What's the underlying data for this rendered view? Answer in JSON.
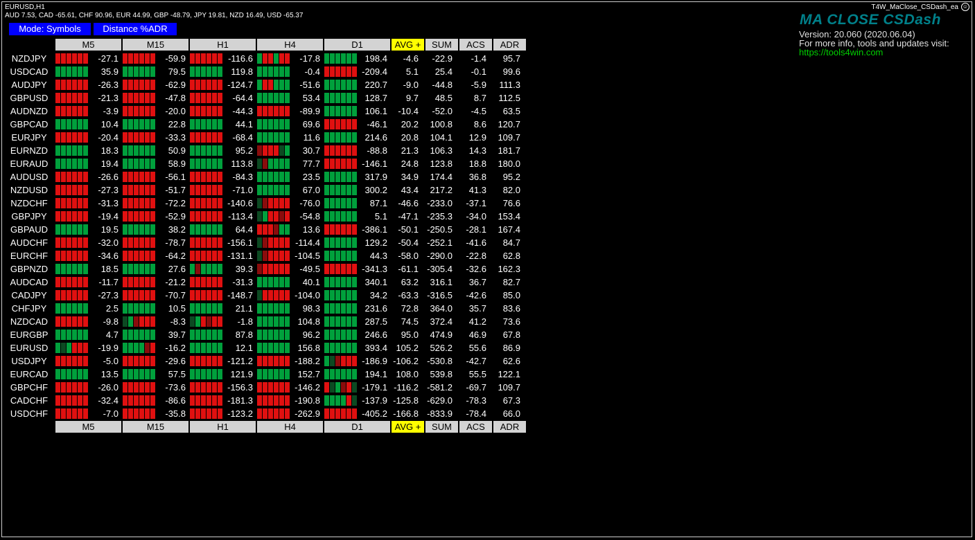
{
  "chart": {
    "title": "EURUSD,H1",
    "ea_name": "T4W_MaClose_CSDash_ea"
  },
  "currency_strength": "AUD 7.53, CAD -65.61, CHF 90.96, EUR 44.99, GBP -48.79, JPY 19.81, NZD 16.49, USD -65.37",
  "buttons": {
    "mode": "Mode: Symbols",
    "distance": "Distance %ADR"
  },
  "brand": {
    "title": "MA CLOSE CSDash",
    "version": "Version: 20.060 (2020.06.04)",
    "info": "For more info, tools and updates visit:",
    "link": "https://tools4win.com"
  },
  "colors": {
    "green": "#00a03c",
    "red": "#e01010",
    "dark_green": "#0c4a22",
    "dark_red": "#8a0c0c",
    "button_blue": "#0000ff",
    "avg_yellow": "#ffff00",
    "header_gray": "#d3d3d3",
    "brand_teal": "#00808a",
    "link_green": "#00d000"
  },
  "table": {
    "timeframes": [
      "M5",
      "M15",
      "H1",
      "H4",
      "D1"
    ],
    "stat_headers": [
      "AVG +",
      "SUM",
      "ACS",
      "ADR"
    ],
    "rows": [
      {
        "symbol": "NZDJPY",
        "tf": [
          [
            "rrrrrr",
            "-27.1"
          ],
          [
            "rrrrrr",
            "-59.9"
          ],
          [
            "rrrrrr",
            "-116.6"
          ],
          [
            "grrgrr",
            "-17.8"
          ],
          [
            "gggggg",
            "198.4"
          ]
        ],
        "avg": "-4.6",
        "sum": "-22.9",
        "acs": "-1.4",
        "adr": "95.7"
      },
      {
        "symbol": "USDCAD",
        "tf": [
          [
            "gggggg",
            "35.9"
          ],
          [
            "gggggg",
            "79.5"
          ],
          [
            "gggggg",
            "119.8"
          ],
          [
            "gggggg",
            "-0.4"
          ],
          [
            "rrrrrr",
            "-209.4"
          ]
        ],
        "avg": "5.1",
        "sum": "25.4",
        "acs": "-0.1",
        "adr": "99.6"
      },
      {
        "symbol": "AUDJPY",
        "tf": [
          [
            "rrrrrr",
            "-26.3"
          ],
          [
            "rrrrrr",
            "-62.9"
          ],
          [
            "rrrrrr",
            "-124.7"
          ],
          [
            "grrggg",
            "-51.6"
          ],
          [
            "gggggg",
            "220.7"
          ]
        ],
        "avg": "-9.0",
        "sum": "-44.8",
        "acs": "-5.9",
        "adr": "111.3"
      },
      {
        "symbol": "GBPUSD",
        "tf": [
          [
            "rrrrrr",
            "-21.3"
          ],
          [
            "rrrrrr",
            "-47.8"
          ],
          [
            "rrrrrr",
            "-64.4"
          ],
          [
            "gggggg",
            "53.4"
          ],
          [
            "gggggg",
            "128.7"
          ]
        ],
        "avg": "9.7",
        "sum": "48.5",
        "acs": "8.7",
        "adr": "112.5"
      },
      {
        "symbol": "AUDNZD",
        "tf": [
          [
            "rrrrrr",
            "-3.9"
          ],
          [
            "rrrrrr",
            "-20.0"
          ],
          [
            "rrrrrr",
            "-44.3"
          ],
          [
            "rrrrrr",
            "-89.9"
          ],
          [
            "gggggg",
            "106.1"
          ]
        ],
        "avg": "-10.4",
        "sum": "-52.0",
        "acs": "-4.5",
        "adr": "63.5"
      },
      {
        "symbol": "GBPCAD",
        "tf": [
          [
            "gggggg",
            "10.4"
          ],
          [
            "gggggg",
            "22.8"
          ],
          [
            "gggggg",
            "44.1"
          ],
          [
            "gggggg",
            "69.6"
          ],
          [
            "rrrrrr",
            "-46.1"
          ]
        ],
        "avg": "20.2",
        "sum": "100.8",
        "acs": "8.6",
        "adr": "120.7"
      },
      {
        "symbol": "EURJPY",
        "tf": [
          [
            "rrrrrr",
            "-20.4"
          ],
          [
            "rrrrrr",
            "-33.3"
          ],
          [
            "rrrrrr",
            "-68.4"
          ],
          [
            "gggggg",
            "11.6"
          ],
          [
            "gggggg",
            "214.6"
          ]
        ],
        "avg": "20.8",
        "sum": "104.1",
        "acs": "12.9",
        "adr": "109.7"
      },
      {
        "symbol": "EURNZD",
        "tf": [
          [
            "gggggg",
            "18.3"
          ],
          [
            "gggggg",
            "50.9"
          ],
          [
            "gggggg",
            "95.2"
          ],
          [
            "DrrrGg",
            "30.7"
          ],
          [
            "rrrrrr",
            "-88.8"
          ]
        ],
        "avg": "21.3",
        "sum": "106.3",
        "acs": "14.3",
        "adr": "181.7"
      },
      {
        "symbol": "EURAUD",
        "tf": [
          [
            "gggggg",
            "19.4"
          ],
          [
            "gggggg",
            "58.9"
          ],
          [
            "gggggg",
            "113.8"
          ],
          [
            "GRgggg",
            "77.7"
          ],
          [
            "rrrrrr",
            "-146.1"
          ]
        ],
        "avg": "24.8",
        "sum": "123.8",
        "acs": "18.8",
        "adr": "180.0"
      },
      {
        "symbol": "AUDUSD",
        "tf": [
          [
            "rrrrrr",
            "-26.6"
          ],
          [
            "rrrrrr",
            "-56.1"
          ],
          [
            "rrrrrr",
            "-84.3"
          ],
          [
            "gggggg",
            "23.5"
          ],
          [
            "gggggg",
            "317.9"
          ]
        ],
        "avg": "34.9",
        "sum": "174.4",
        "acs": "36.8",
        "adr": "95.2"
      },
      {
        "symbol": "NZDUSD",
        "tf": [
          [
            "rrrrrr",
            "-27.3"
          ],
          [
            "rrrrrr",
            "-51.7"
          ],
          [
            "rrrrrr",
            "-71.0"
          ],
          [
            "gggggg",
            "67.0"
          ],
          [
            "gggggg",
            "300.2"
          ]
        ],
        "avg": "43.4",
        "sum": "217.2",
        "acs": "41.3",
        "adr": "82.0"
      },
      {
        "symbol": "NZDCHF",
        "tf": [
          [
            "rrrrrr",
            "-31.3"
          ],
          [
            "rrrrrr",
            "-72.2"
          ],
          [
            "rrrrrr",
            "-140.6"
          ],
          [
            "GDrrrr",
            "-76.0"
          ],
          [
            "gggggg",
            "87.1"
          ]
        ],
        "avg": "-46.6",
        "sum": "-233.0",
        "acs": "-37.1",
        "adr": "76.6"
      },
      {
        "symbol": "GBPJPY",
        "tf": [
          [
            "rrrrrr",
            "-19.4"
          ],
          [
            "rrrrrr",
            "-52.9"
          ],
          [
            "rrrrrr",
            "-113.4"
          ],
          [
            "GgrrRr",
            "-54.8"
          ],
          [
            "gggggg",
            "5.1"
          ]
        ],
        "avg": "-47.1",
        "sum": "-235.3",
        "acs": "-34.0",
        "adr": "153.4"
      },
      {
        "symbol": "GBPAUD",
        "tf": [
          [
            "gggggg",
            "19.5"
          ],
          [
            "gggggg",
            "38.2"
          ],
          [
            "gggggg",
            "64.4"
          ],
          [
            "rrrRgg",
            "13.6"
          ],
          [
            "rrrrrr",
            "-386.1"
          ]
        ],
        "avg": "-50.1",
        "sum": "-250.5",
        "acs": "-28.1",
        "adr": "167.4"
      },
      {
        "symbol": "AUDCHF",
        "tf": [
          [
            "rrrrrr",
            "-32.0"
          ],
          [
            "rrrrrr",
            "-78.7"
          ],
          [
            "rrrrrr",
            "-156.1"
          ],
          [
            "GDrrrr",
            "-114.4"
          ],
          [
            "gggggg",
            "129.2"
          ]
        ],
        "avg": "-50.4",
        "sum": "-252.1",
        "acs": "-41.6",
        "adr": "84.7"
      },
      {
        "symbol": "EURCHF",
        "tf": [
          [
            "rrrrrr",
            "-34.6"
          ],
          [
            "rrrrrr",
            "-64.2"
          ],
          [
            "rrrrrr",
            "-131.1"
          ],
          [
            "GDrrrr",
            "-104.5"
          ],
          [
            "gggggg",
            "44.3"
          ]
        ],
        "avg": "-58.0",
        "sum": "-290.0",
        "acs": "-22.8",
        "adr": "62.8"
      },
      {
        "symbol": "GBPNZD",
        "tf": [
          [
            "gggggg",
            "18.5"
          ],
          [
            "gggggg",
            "27.6"
          ],
          [
            "gDgggg",
            "39.3"
          ],
          [
            "Drrrrr",
            "-49.5"
          ],
          [
            "rrrrrr",
            "-341.3"
          ]
        ],
        "avg": "-61.1",
        "sum": "-305.4",
        "acs": "-32.6",
        "adr": "162.3"
      },
      {
        "symbol": "AUDCAD",
        "tf": [
          [
            "rrrrrr",
            "-11.7"
          ],
          [
            "rrrrrr",
            "-21.2"
          ],
          [
            "rrrrrr",
            "-31.3"
          ],
          [
            "gggggg",
            "40.1"
          ],
          [
            "gggggg",
            "340.1"
          ]
        ],
        "avg": "63.2",
        "sum": "316.1",
        "acs": "36.7",
        "adr": "82.7"
      },
      {
        "symbol": "CADJPY",
        "tf": [
          [
            "rrrrrr",
            "-27.3"
          ],
          [
            "rrrrrr",
            "-70.7"
          ],
          [
            "rrrrrr",
            "-148.7"
          ],
          [
            "Grrrrr",
            "-104.0"
          ],
          [
            "gggggg",
            "34.2"
          ]
        ],
        "avg": "-63.3",
        "sum": "-316.5",
        "acs": "-42.6",
        "adr": "85.0"
      },
      {
        "symbol": "CHFJPY",
        "tf": [
          [
            "gggggg",
            "2.5"
          ],
          [
            "gggggg",
            "10.5"
          ],
          [
            "gggggg",
            "21.1"
          ],
          [
            "gggggg",
            "98.3"
          ],
          [
            "gggggg",
            "231.6"
          ]
        ],
        "avg": "72.8",
        "sum": "364.0",
        "acs": "35.7",
        "adr": "83.6"
      },
      {
        "symbol": "NZDCAD",
        "tf": [
          [
            "rrrrrr",
            "-9.8"
          ],
          [
            "GgDrrr",
            "-8.3"
          ],
          [
            "GgrDrr",
            "-1.8"
          ],
          [
            "gggggg",
            "104.8"
          ],
          [
            "gggggg",
            "287.5"
          ]
        ],
        "avg": "74.5",
        "sum": "372.4",
        "acs": "41.2",
        "adr": "73.6"
      },
      {
        "symbol": "EURGBP",
        "tf": [
          [
            "gggggg",
            "4.7"
          ],
          [
            "gggggg",
            "39.7"
          ],
          [
            "gggggg",
            "87.8"
          ],
          [
            "gggggg",
            "96.2"
          ],
          [
            "gggggg",
            "246.6"
          ]
        ],
        "avg": "95.0",
        "sum": "474.9",
        "acs": "46.9",
        "adr": "67.8"
      },
      {
        "symbol": "EURUSD",
        "tf": [
          [
            "gGgrrr",
            "-19.9"
          ],
          [
            "ggggDr",
            "-16.2"
          ],
          [
            "gggggg",
            "12.1"
          ],
          [
            "gggggg",
            "156.8"
          ],
          [
            "gggggg",
            "393.4"
          ]
        ],
        "avg": "105.2",
        "sum": "526.2",
        "acs": "55.6",
        "adr": "86.9"
      },
      {
        "symbol": "USDJPY",
        "tf": [
          [
            "rrrrrr",
            "-5.0"
          ],
          [
            "rrrrrr",
            "-29.6"
          ],
          [
            "rrrrrr",
            "-121.2"
          ],
          [
            "rrrrrr",
            "-188.2"
          ],
          [
            "gGDrrr",
            "-186.9"
          ]
        ],
        "avg": "-106.2",
        "sum": "-530.8",
        "acs": "-42.7",
        "adr": "62.6"
      },
      {
        "symbol": "EURCAD",
        "tf": [
          [
            "gggggg",
            "13.5"
          ],
          [
            "gggggg",
            "57.5"
          ],
          [
            "gggggg",
            "121.9"
          ],
          [
            "gggggg",
            "152.7"
          ],
          [
            "gggggg",
            "194.1"
          ]
        ],
        "avg": "108.0",
        "sum": "539.8",
        "acs": "55.5",
        "adr": "122.1"
      },
      {
        "symbol": "GBPCHF",
        "tf": [
          [
            "rrrrrr",
            "-26.0"
          ],
          [
            "rrrrrr",
            "-73.6"
          ],
          [
            "rrrrrr",
            "-156.3"
          ],
          [
            "rrrrrr",
            "-146.2"
          ],
          [
            "rGgDrG",
            "-179.1"
          ]
        ],
        "avg": "-116.2",
        "sum": "-581.2",
        "acs": "-69.7",
        "adr": "109.7"
      },
      {
        "symbol": "CADCHF",
        "tf": [
          [
            "rrrrrr",
            "-32.4"
          ],
          [
            "rrrrrr",
            "-86.6"
          ],
          [
            "rrrrrr",
            "-181.3"
          ],
          [
            "rrrrrr",
            "-190.8"
          ],
          [
            "ggggrG",
            "-137.9"
          ]
        ],
        "avg": "-125.8",
        "sum": "-629.0",
        "acs": "-78.3",
        "adr": "67.3"
      },
      {
        "symbol": "USDCHF",
        "tf": [
          [
            "rrrrrr",
            "-7.0"
          ],
          [
            "rrrrrr",
            "-35.8"
          ],
          [
            "rrrrrr",
            "-123.2"
          ],
          [
            "rrrrrr",
            "-262.9"
          ],
          [
            "rrrrrr",
            "-405.2"
          ]
        ],
        "avg": "-166.8",
        "sum": "-833.9",
        "acs": "-78.4",
        "adr": "66.0"
      }
    ]
  }
}
